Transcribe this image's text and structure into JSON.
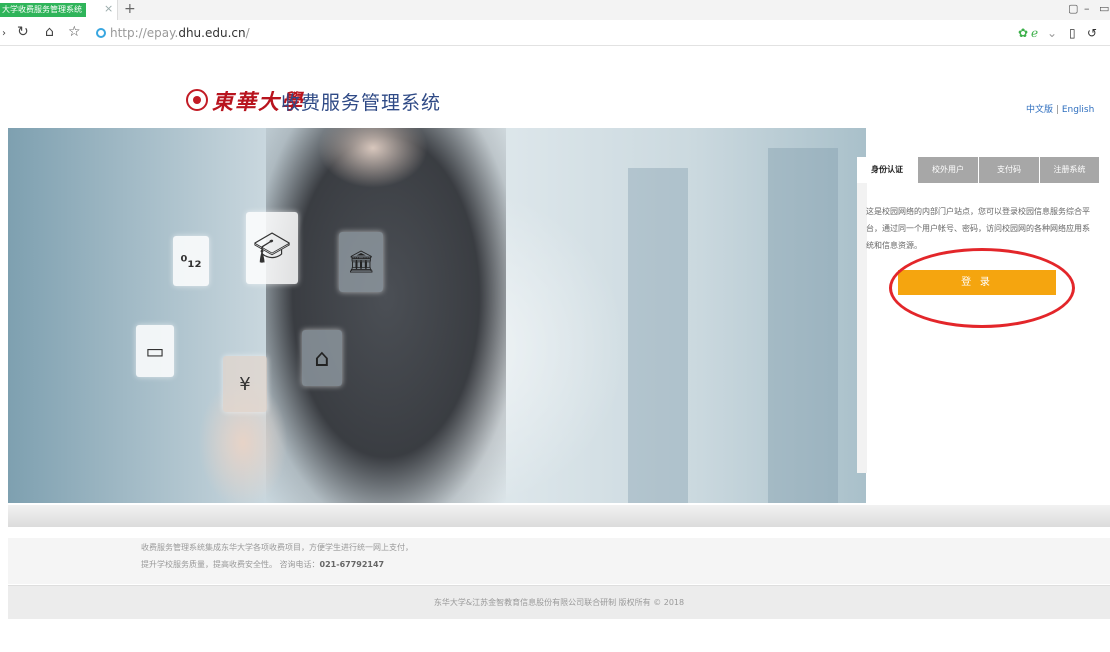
{
  "browser": {
    "tab_title": "大学收费服务管理系统",
    "tab_close": "×",
    "new_tab": "+",
    "url_protocol": "http://epay.",
    "url_domain": "dhu.edu.cn",
    "url_path": "/",
    "window_controls": [
      "▢",
      "–",
      "▭"
    ],
    "nav_icons": [
      "back-icon",
      "reload-icon",
      "home-icon",
      "star-icon"
    ]
  },
  "header": {
    "logo_calligraphy": "東華大學",
    "system_title": "收费服务管理系统",
    "lang_cn": "中文版",
    "lang_sep": "|",
    "lang_en": "English"
  },
  "login": {
    "tabs": [
      "身份认证",
      "校外用户",
      "支付码",
      "注册系统"
    ],
    "active_tab": 0,
    "description": "这是校园网络的内部门户站点，您可以登录校园信息服务综合平台，通过同一个用户帐号、密码，访问校园网的各种网络应用系统和信息资源。",
    "login_button": "登 录",
    "highlight_color": "#e3262a",
    "button_color": "#f5a50f"
  },
  "banner": {
    "icons": [
      "number-icon",
      "graduation-cap-icon",
      "bank-icon",
      "credit-card-icon",
      "home-icon",
      "mobile-payment-icon"
    ]
  },
  "footer": {
    "info_line1": "收费服务管理系统集成东华大学各项收费项目，方便学生进行统一网上支付，",
    "info_line2_prefix": "提升学校服务质量，提高收费安全性。 咨询电话：",
    "phone": "021-67792147",
    "copyright": "东华大学&江苏金智教育信息股份有限公司联合研制 版权所有 © 2018"
  }
}
